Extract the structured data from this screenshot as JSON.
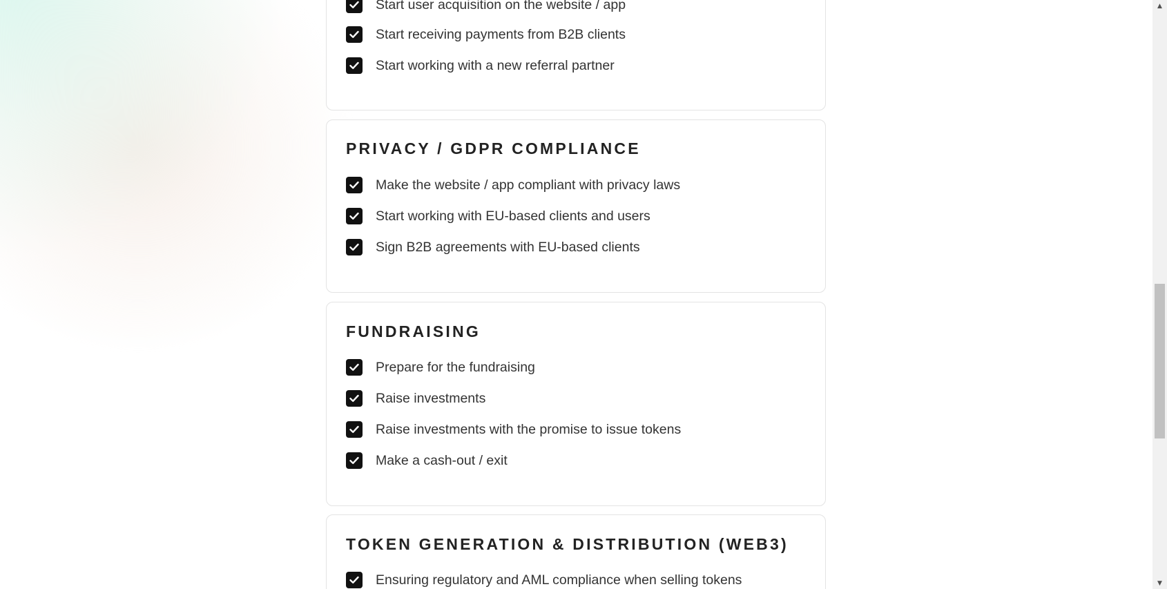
{
  "sections": [
    {
      "title": "",
      "items": [
        "Start user acquisition on the website / app",
        "Start receiving payments from B2B clients",
        "Start working with a new referral partner"
      ]
    },
    {
      "title": "PRIVACY / GDPR COMPLIANCE",
      "items": [
        "Make the website / app compliant with privacy laws",
        "Start working with EU-based clients and users",
        "Sign B2B agreements with EU-based clients"
      ]
    },
    {
      "title": "FUNDRAISING",
      "items": [
        "Prepare for the fundraising",
        "Raise investments",
        "Raise investments with the promise to issue tokens",
        "Make a cash-out / exit"
      ]
    },
    {
      "title": "TOKEN GENERATION & DISTRIBUTION (WEB3)",
      "items": [
        "Ensuring regulatory and AML compliance when selling tokens"
      ]
    }
  ],
  "scrollbar": {
    "up_arrow": "▲",
    "down_arrow": "▼"
  },
  "colors": {
    "checkbox": "#111111",
    "card_border": "#e3e3e3",
    "text": "#333333",
    "title": "#222222"
  }
}
